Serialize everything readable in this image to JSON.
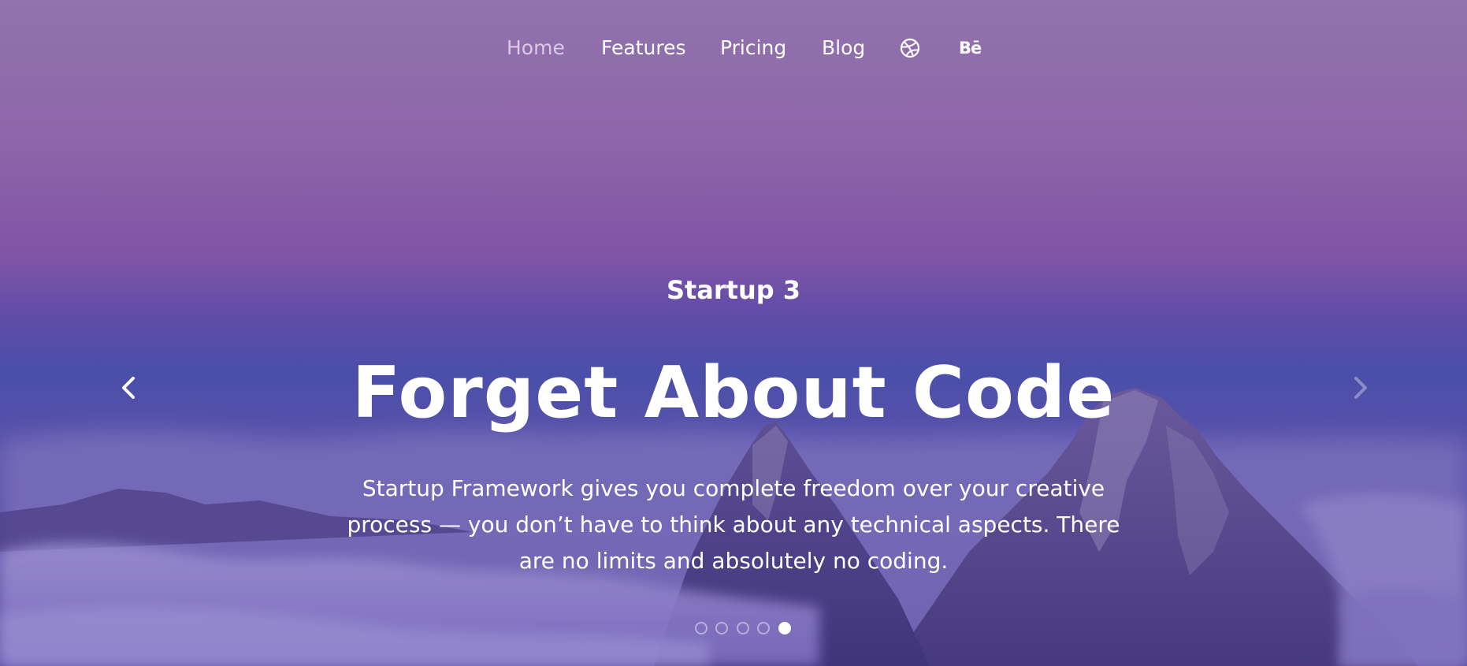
{
  "nav": {
    "items": [
      {
        "label": "Home",
        "active": true
      },
      {
        "label": "Features",
        "active": false
      },
      {
        "label": "Pricing",
        "active": false
      },
      {
        "label": "Blog",
        "active": false
      }
    ],
    "social": {
      "dribbble_icon": "dribbble-icon",
      "behance_label": "Bē"
    }
  },
  "hero": {
    "eyebrow": "Startup 3",
    "headline": "Forget About Code",
    "body": "Startup Framework gives you complete freedom over your creative process — you don’t have to think about any technical aspects. There are no limits and absolutely no coding."
  },
  "carousel": {
    "prev_icon": "chevron-left-icon",
    "next_icon": "chevron-right-icon",
    "slide_count": 5,
    "active_slide": 5
  },
  "colors": {
    "sky_top": "#9173ad",
    "sky_mid": "#8154a6",
    "horizon": "#4a4fa9",
    "text": "#ffffff",
    "nav_active": "#d8cbe3"
  }
}
